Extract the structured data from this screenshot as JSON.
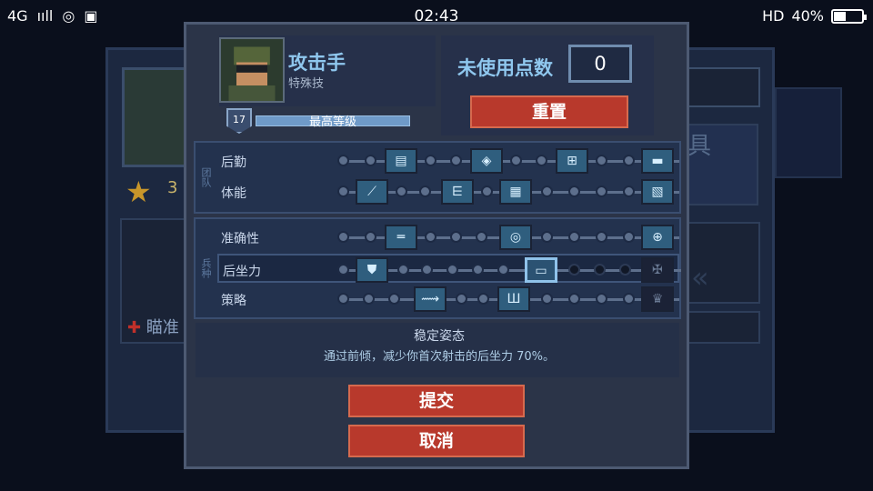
{
  "status_bar": {
    "network": "4G",
    "signal": "ııll",
    "time": "02:43",
    "hd": "HD",
    "battery": "40%"
  },
  "background": {
    "star_count": "3",
    "aim_label": "瞄准",
    "right_text": "具"
  },
  "hero": {
    "name": "攻击手",
    "subtitle": "特殊技",
    "level": "17",
    "level_text": "最高等级"
  },
  "points": {
    "label": "未使用点数",
    "value": "0",
    "reset_label": "重置"
  },
  "groups": {
    "team": {
      "side_label": "团队",
      "rows": [
        {
          "name": "后勤"
        },
        {
          "name": "体能"
        }
      ]
    },
    "soldier": {
      "side_label": "兵种",
      "rows": [
        {
          "name": "准确性"
        },
        {
          "name": "后坐力"
        },
        {
          "name": "策略"
        }
      ]
    }
  },
  "description": {
    "title": "稳定姿态",
    "text": "通过前倾，减少你首次射击的后坐力 70%。"
  },
  "buttons": {
    "submit": "提交",
    "cancel": "取消"
  },
  "colors": {
    "accent_blue": "#8fc7ee",
    "button_red": "#b8392c",
    "panel": "#2b3448"
  }
}
